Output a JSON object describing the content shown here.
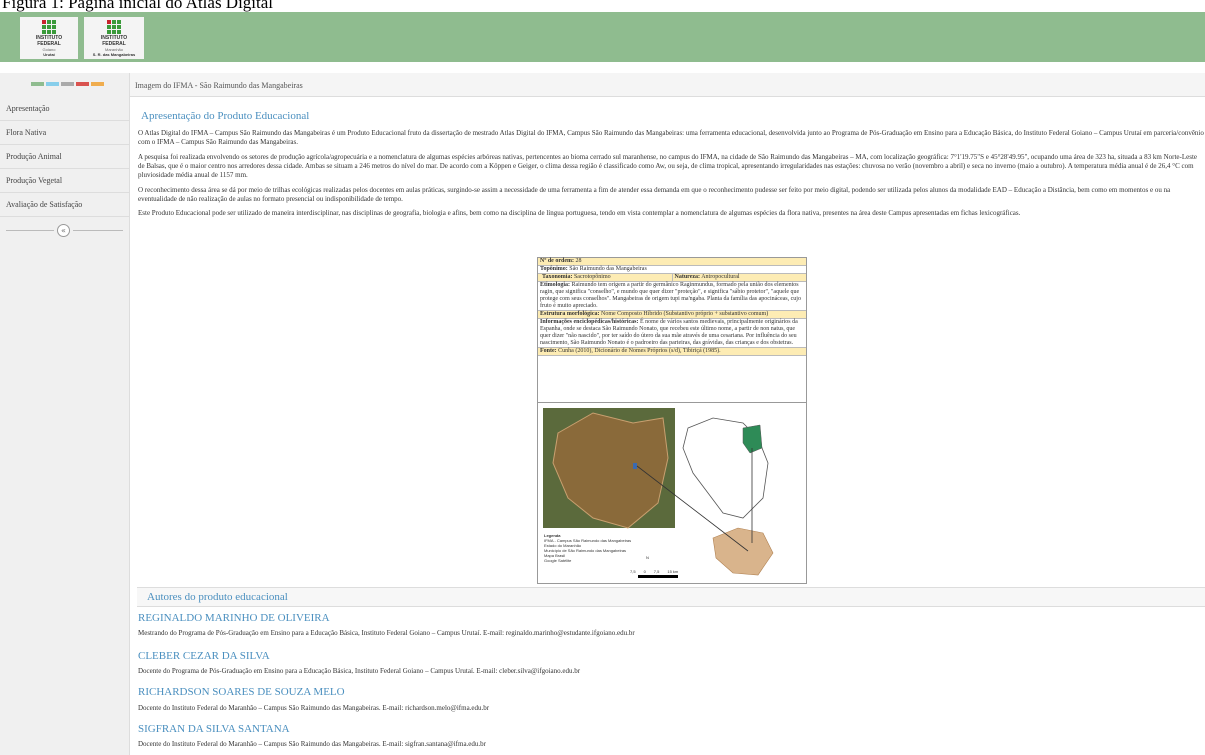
{
  "figure_caption": "Figura 1: Página inicial do Atlas Digital",
  "header": {
    "logo1": {
      "line1": "INSTITUTO",
      "line2": "FEDERAL",
      "line3": "Goiano",
      "line4": "Urutaí"
    },
    "logo2": {
      "line1": "INSTITUTO",
      "line2": "FEDERAL",
      "line3": "Maranhão",
      "line4": "S. R. das Mangabeiras"
    },
    "background_color": "#8fbc8f"
  },
  "sidebar": {
    "color_strip": [
      "#8fbc8f",
      "#87ceeb",
      "#aaaaaa",
      "#d9534f",
      "#f0ad4e"
    ],
    "items": [
      {
        "label": "Apresentação"
      },
      {
        "label": "Flora Nativa"
      },
      {
        "label": "Produção Animal"
      },
      {
        "label": "Produção Vegetal"
      },
      {
        "label": "Avaliação de Satisfação"
      }
    ],
    "collapse_icon": "chevron-left-icon",
    "collapse_glyph": "«"
  },
  "top_bar": {
    "text": "Imagem do IFMA - São Raimundo das Mangabeiras"
  },
  "main": {
    "title": "Apresentação do Produto Educacional",
    "paragraphs": [
      "O Atlas Digital do IFMA – Campus São Raimundo das Mangabeiras é um Produto Educacional fruto da dissertação de mestrado Atlas Digital do IFMA, Campus São Raimundo das Mangabeiras: uma ferramenta educacional, desenvolvida junto ao Programa de Pós-Graduação em Ensino para a Educação Básica, do Instituto Federal Goiano – Campus Urutaí em parceria/convênio com o IFMA – Campus São Raimundo das Mangabeiras.",
      "A pesquisa foi realizada envolvendo os setores de produção agrícola/agropecuária e a nomenclatura de algumas espécies arbóreas nativas, pertencentes ao bioma cerrado sul maranhense, no campus do IFMA, na cidade de São Raimundo das Mangabeiras – MA, com localização geográfica: 7°1'19.75\"S e 45°28'49.95\", ocupando uma área de 323 ha, situada a 83 km Norte-Leste de Balsas, que é o maior centro nos arredores dessa cidade. Ambas se situam a 246 metros do nível do mar. De acordo com a Köppen e Geiger, o clima dessa região é classificado como Aw, ou seja, de clima tropical, apresentando irregularidades nas estações: chuvosa no verão (novembro a abril) e seca no inverno (maio a outubro). A temperatura média anual é de 26,4 °C com pluviosidade média anual de 1157 mm.",
      "O reconhecimento dessa área se dá por meio de trilhas ecológicas realizadas pelos docentes em aulas práticas, surgindo-se assim a necessidade de uma ferramenta a fim de atender essa demanda em que o reconhecimento pudesse ser feito por meio digital, podendo ser utilizada pelos alunos da modalidade EAD – Educação a Distância, bem como em momentos e ou na eventualidade de não realização de aulas no formato presencial ou indisponibilidade de tempo.",
      "Este Produto Educacional pode ser utilizado de maneira interdisciplinar, nas disciplinas de geografia, biologia e afins, bem como na disciplina de língua portuguesa, tendo em vista contemplar a nomenclatura de algumas espécies da flora nativa, presentes na área deste Campus apresentadas em fichas lexicográficas."
    ]
  },
  "card": {
    "ordem_label": "Nº de ordem:",
    "ordem_value": "28",
    "toponimo_label": "Topônimo:",
    "toponimo_value": "São Raimundo das Mangabeiras",
    "taxonomia_label": "Taxonomia:",
    "taxonomia_value": "Sacrotopônimo",
    "natureza_label": "Natureza:",
    "natureza_value": "Antropocultural",
    "etimologia_label": "Etimologia:",
    "etimologia_value": "Raimundo tem origem a partir do germânico Raginmundus, formado pela união dos elementos ragin, que significa \"conselho\", e mundo que quer dizer \"proteção\", e significa \"sábio protetor\", \"aquele que protege com seus conselhos\". Mangabeiras de origem tupi ma'ngaba. Planta da família das apocináceas, cujo fruto é muito apreciado.",
    "estrutura_label": "Estrutura morfológica:",
    "estrutura_value": "Nome Composto Híbrido (Substantivo próprio + substantivo comum)",
    "info_label": "Informações enciclopédicas/históricas:",
    "info_value": "É nome de vários santos medievais, principalmente originários da Espanha, onde se destaca São Raimundo Nonato, que recebeu este último nome, a partir de non natus, que quer dizer \"não nascido\", por ter saído do útero da sua mãe através de uma cesariana. Por influência do seu nascimento, São Raimundo Nonato é o padroeiro das parteiras, das grávidas, das crianças e dos obstetras.",
    "fonte_label": "Fonte:",
    "fonte_value": "Cunha (2010), Dicionário de Nomes Próprios (s/d), Tibiriçá (1985)."
  },
  "map": {
    "legend_title": "Legenda",
    "legend_items": [
      "IFMA - Campus São Raimundo das Mangabeiras",
      "Estado do Maranhão",
      "Município de São Raimundo das Mangabeiras",
      "Mapa Brasil",
      "Google Satélite"
    ],
    "scale_labels": [
      "7,5",
      "0",
      "7,5",
      "15 km"
    ],
    "north_label": "N"
  },
  "authors": {
    "section_title": "Autores do produto educacional",
    "list": [
      {
        "name": "REGINALDO MARINHO DE OLIVEIRA",
        "desc": "Mestrando do Programa de Pós-Graduação em Ensino para a Educação Básica, Instituto Federal Goiano – Campus Urutaí. E-mail: reginaldo.marinho@estudante.ifgoiano.edu.br"
      },
      {
        "name": "CLEBER CEZAR DA SILVA",
        "desc": "Docente do Programa de Pós-Graduação em Ensino para a Educação Básica, Instituto Federal Goiano – Campus Urutaí. E-mail: cleber.silva@ifgoiano.edu.br"
      },
      {
        "name": "RICHARDSON SOARES DE SOUZA MELO",
        "desc": "Docente do Instituto Federal do Maranhão – Campus São Raimundo das Mangabeiras. E-mail: richardson.melo@ifma.edu.br"
      },
      {
        "name": "SIGFRAN DA SILVA SANTANA",
        "desc": "Docente do Instituto Federal do Maranhão – Campus São Raimundo das Mangabeiras. E-mail: sigfran.santana@ifma.edu.br"
      }
    ]
  }
}
